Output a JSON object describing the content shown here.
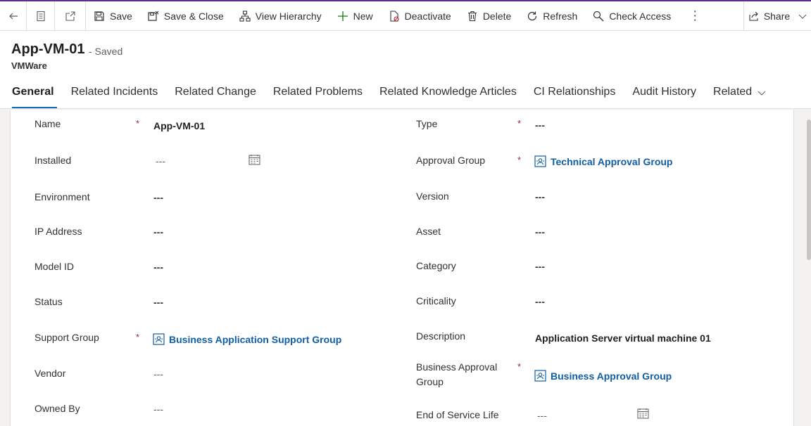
{
  "commands": {
    "save": "Save",
    "save_close": "Save & Close",
    "view_hierarchy": "View Hierarchy",
    "new": "New",
    "deactivate": "Deactivate",
    "delete": "Delete",
    "refresh": "Refresh",
    "check_access": "Check Access",
    "more": "⋮",
    "share": "Share"
  },
  "record": {
    "title": "App-VM-01",
    "status": "- Saved",
    "entity": "VMWare"
  },
  "tabs": [
    {
      "label": "General",
      "active": true
    },
    {
      "label": "Related Incidents"
    },
    {
      "label": "Related Change"
    },
    {
      "label": "Related Problems"
    },
    {
      "label": "Related Knowledge Articles"
    },
    {
      "label": "CI Relationships"
    },
    {
      "label": "Audit History"
    },
    {
      "label": "Related"
    }
  ],
  "left_fields": [
    {
      "label": "Name",
      "value": "App-VM-01",
      "required": true
    },
    {
      "label": "Installed",
      "value": "---"
    },
    {
      "label": "Environment",
      "value": "---"
    },
    {
      "label": "IP Address",
      "value": "---"
    },
    {
      "label": "Model ID",
      "value": "---"
    },
    {
      "label": "Status",
      "value": "---"
    },
    {
      "label": "Support Group",
      "value": "Business Application Support Group",
      "required": true
    },
    {
      "label": "Vendor",
      "value": "---"
    },
    {
      "label": "Owned By",
      "value": "---"
    }
  ],
  "right_fields": [
    {
      "label": "Type",
      "value": "---",
      "required": true
    },
    {
      "label": "Approval Group",
      "value": "Technical Approval Group",
      "required": true
    },
    {
      "label": "Version",
      "value": "---"
    },
    {
      "label": "Asset",
      "value": "---"
    },
    {
      "label": "Category",
      "value": "---"
    },
    {
      "label": "Criticality",
      "value": "---"
    },
    {
      "label": "Description",
      "value": "Application Server virtual machine 01"
    },
    {
      "label": "Business Approval Group",
      "label_line1": "Business Approval",
      "label_line2": "Group",
      "value": "Business Approval Group",
      "required": true
    },
    {
      "label": "End of Service Life",
      "value": "---"
    }
  ],
  "required_marker": "*",
  "colors": {
    "accent": "#5c2d91",
    "link": "#115ea3",
    "required": "#a4262c",
    "tab_underline": "#0f6cbd"
  }
}
